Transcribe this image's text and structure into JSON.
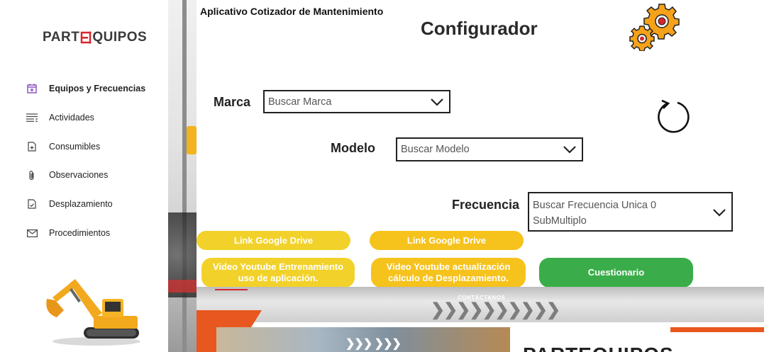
{
  "sidebar": {
    "logo_text_left": "PART",
    "logo_text_right": "QUIPOS",
    "items": [
      {
        "label": "Equipos y Frecuencias",
        "icon": "calendar-icon",
        "active": true
      },
      {
        "label": "Actividades",
        "icon": "list-icon",
        "active": false
      },
      {
        "label": "Consumibles",
        "icon": "add-document-icon",
        "active": false
      },
      {
        "label": "Observaciones",
        "icon": "paperclip-icon",
        "active": false
      },
      {
        "label": "Desplazamiento",
        "icon": "checked-document-icon",
        "active": false
      },
      {
        "label": "Procedimientos",
        "icon": "mail-icon",
        "active": false
      }
    ]
  },
  "header": {
    "app_title": "Aplicativo Cotizador de Mantenimiento",
    "page_title": "Configurador"
  },
  "form": {
    "marca": {
      "label": "Marca",
      "placeholder": "Buscar Marca"
    },
    "modelo": {
      "label": "Modelo",
      "placeholder": "Buscar Modelo"
    },
    "frecuencia": {
      "label": "Frecuencia",
      "placeholder_line1": "Buscar Frecuencia Unica 0",
      "placeholder_line2": "SubMultiplo"
    }
  },
  "buttons": {
    "drive1": "Link Google Drive",
    "drive2": "Link Google Drive",
    "video1_line1": "Video Youtube Entrenamiento",
    "video1_line2": "uso de aplicación.",
    "video2_line1": "Video Youtube actualización",
    "video2_line2": "cálculo de Desplazamiento.",
    "quiz": "Cuestionario"
  },
  "banner": {
    "contact": "CONTÁCTANOS",
    "brand": "PARTEQUIPOS"
  },
  "colors": {
    "accent_purple": "#7b3fb8",
    "yellow_light": "#f2d22a",
    "yellow": "#f6c21c",
    "green": "#3aad4a",
    "brand_red": "#d8262b",
    "brand_orange": "#e8571f"
  }
}
